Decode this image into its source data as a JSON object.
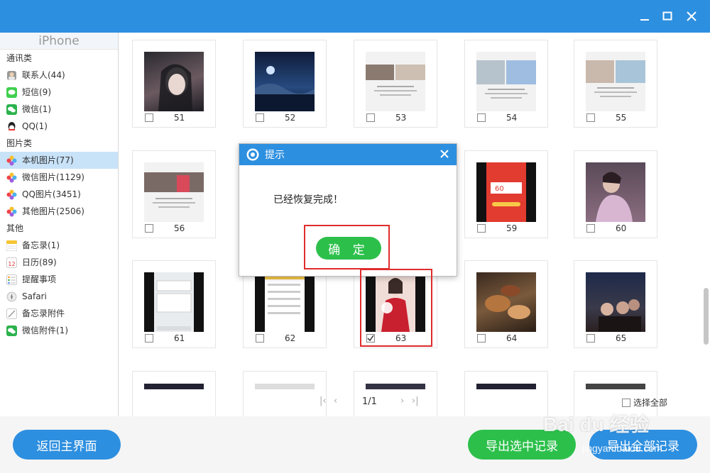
{
  "window": {
    "controls": [
      "minimize-icon",
      "maximize-icon",
      "close-icon"
    ]
  },
  "sidebar": {
    "device": "iPhone",
    "groups": [
      {
        "label": "通讯类",
        "items": [
          {
            "label": "联系人(44)",
            "icon": "contacts-icon"
          },
          {
            "label": "短信(9)",
            "icon": "sms-icon"
          },
          {
            "label": "微信(1)",
            "icon": "wechat-icon"
          },
          {
            "label": "QQ(1)",
            "icon": "qq-icon"
          }
        ]
      },
      {
        "label": "图片类",
        "items": [
          {
            "label": "本机图片(77)",
            "icon": "photos-icon",
            "active": true
          },
          {
            "label": "微信图片(1129)",
            "icon": "photos-icon"
          },
          {
            "label": "QQ图片(3451)",
            "icon": "photos-icon"
          },
          {
            "label": "其他图片(2506)",
            "icon": "photos-icon"
          }
        ]
      },
      {
        "label": "其他",
        "items": [
          {
            "label": "备忘录(1)",
            "icon": "notes-icon"
          },
          {
            "label": "日历(89)",
            "icon": "calendar-icon"
          },
          {
            "label": "提醒事项",
            "icon": "reminders-icon"
          },
          {
            "label": "Safari",
            "icon": "safari-icon"
          },
          {
            "label": "备忘录附件",
            "icon": "notes-attachment-icon"
          },
          {
            "label": "微信附件(1)",
            "icon": "wechat-icon"
          }
        ]
      }
    ]
  },
  "gallery": {
    "tiles": [
      {
        "num": "51",
        "checked": false
      },
      {
        "num": "52",
        "checked": false
      },
      {
        "num": "53",
        "checked": false
      },
      {
        "num": "54",
        "checked": false
      },
      {
        "num": "55",
        "checked": false
      },
      {
        "num": "56",
        "checked": false
      },
      {
        "num": "",
        "checked": false
      },
      {
        "num": "",
        "checked": false
      },
      {
        "num": "59",
        "checked": false
      },
      {
        "num": "60",
        "checked": false
      },
      {
        "num": "61",
        "checked": false
      },
      {
        "num": "62",
        "checked": false
      },
      {
        "num": "63",
        "checked": true
      },
      {
        "num": "64",
        "checked": false
      },
      {
        "num": "65",
        "checked": false
      }
    ]
  },
  "pager": {
    "page": "1/1"
  },
  "select_all": "选择全部",
  "footer": {
    "back": "返回主界面",
    "export_selected": "导出选中记录",
    "export_all": "导出全部记录"
  },
  "dialog": {
    "title": "提示",
    "message": "已经恢复完成！",
    "ok": "确 定"
  },
  "watermark": {
    "text": "Bai du 经验",
    "sub": "jingyan.baidu.com"
  },
  "colors": {
    "titlebar": "#2d8fe0",
    "accent_green": "#2cc04b",
    "highlight": "#e02c2c"
  }
}
